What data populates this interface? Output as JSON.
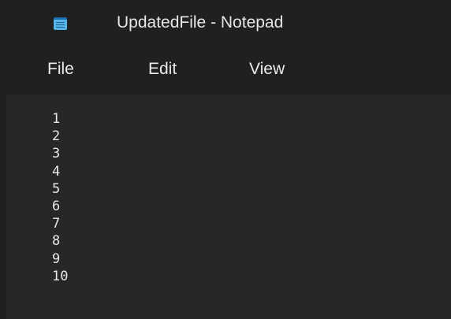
{
  "window": {
    "title": "UpdatedFile - Notepad",
    "icon": "notepad-icon"
  },
  "menu": {
    "file": "File",
    "edit": "Edit",
    "view": "View"
  },
  "editor": {
    "lines": [
      "1",
      "2",
      "3",
      "4",
      "5",
      "6",
      "7",
      "8",
      "9",
      "10"
    ]
  },
  "colors": {
    "titlebar_bg": "#202020",
    "editor_bg": "#272727",
    "text": "#e8e8e8",
    "icon_accent": "#56b6e8"
  }
}
